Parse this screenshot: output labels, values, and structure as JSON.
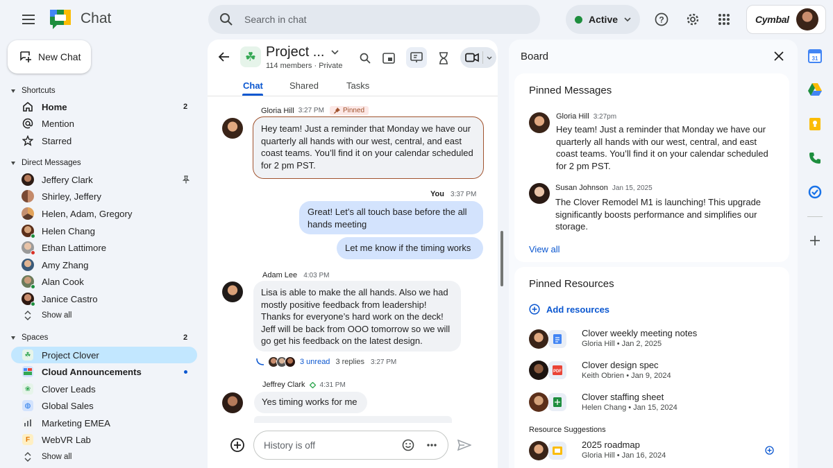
{
  "app": {
    "title": "Chat",
    "brand": "Cymbal"
  },
  "search": {
    "placeholder": "Search in chat"
  },
  "status": {
    "label": "Active",
    "color": "#1e8e3e"
  },
  "left_nav": {
    "new_chat_label": "New Chat",
    "shortcuts": {
      "header": "Shortcuts",
      "items": [
        {
          "label": "Home",
          "badge": "2",
          "icon": "home-icon"
        },
        {
          "label": "Mention",
          "icon": "at-icon"
        },
        {
          "label": "Starred",
          "icon": "star-icon"
        }
      ]
    },
    "direct_messages": {
      "header": "Direct Messages",
      "items": [
        {
          "label": "Jeffery Clark",
          "pinned": true
        },
        {
          "label": "Shirley, Jeffery"
        },
        {
          "label": "Helen, Adam, Gregory"
        },
        {
          "label": "Helen Chang"
        },
        {
          "label": "Ethan Lattimore"
        },
        {
          "label": "Amy Zhang"
        },
        {
          "label": "Alan Cook"
        },
        {
          "label": "Janice Castro"
        }
      ],
      "show_all": "Show all"
    },
    "spaces": {
      "header": "Spaces",
      "badge": "2",
      "items": [
        {
          "label": "Project Clover",
          "active": true
        },
        {
          "label": "Cloud Announcements",
          "bold": true,
          "unread_dot": true
        },
        {
          "label": "Clover Leads"
        },
        {
          "label": "Global Sales"
        },
        {
          "label": "Marketing EMEA"
        },
        {
          "label": "WebVR Lab",
          "icon_letter": "F"
        }
      ],
      "show_all": "Show all"
    }
  },
  "chat": {
    "space_name": "Project ...",
    "space_meta": "114 members · Private",
    "tabs": [
      "Chat",
      "Shared",
      "Tasks"
    ],
    "active_tab": "Chat",
    "messages": {
      "m1": {
        "sender": "Gloria Hill",
        "time": "3:27 PM",
        "pinned_label": "Pinned",
        "text": "Hey team! Just a reminder that Monday we have our quarterly all hands with our west, central, and east coast teams. You’ll find it on your calendar scheduled for 2 pm PST."
      },
      "m2": {
        "sender": "You",
        "time": "3:37 PM",
        "text": "Great! Let’s all touch base before the all hands meeting",
        "text2": "Let me know if the timing works"
      },
      "m3": {
        "sender": "Adam Lee",
        "time": "4:03 PM",
        "text": "Lisa is able to make the all hands. Also we had mostly positive feedback from leadership! Thanks for everyone’s hard work on the deck! Jeff will  be back from OOO tomorrow so we will go get his feedback on the latest design.",
        "unread": "3 unread",
        "replies": "3 replies",
        "reply_time": "3:27 PM"
      },
      "m4": {
        "sender": "Jeffrey Clark",
        "time": "4:31 PM",
        "text": "Yes timing works for me"
      }
    },
    "composer_placeholder": "History is off"
  },
  "board": {
    "title": "Board",
    "pinned_messages": {
      "header": "Pinned Messages",
      "items": [
        {
          "sender": "Gloria Hill",
          "time": "3:27pm",
          "text": "Hey team! Just a reminder that Monday we have our quarterly all hands with our west, central, and east coast teams. You’ll find it on your calendar scheduled for 2 pm PST."
        },
        {
          "sender": "Susan Johnson",
          "time": "Jan 15, 2025",
          "text": "The Clover Remodel M1 is launching! This upgrade significantly boosts performance and simplifies our storage."
        }
      ],
      "view_all": "View all"
    },
    "pinned_resources": {
      "header": "Pinned Resources",
      "add_label": "Add resources",
      "items": [
        {
          "title": "Clover weekly meeting notes",
          "sub": "Gloria Hill  •  Jan 2, 2025",
          "file_icon": "docs-icon"
        },
        {
          "title": "Clover design spec",
          "sub": "Keith Obrien  •  Jan 9, 2024",
          "file_icon": "pdf-icon"
        },
        {
          "title": "Clover staffing sheet",
          "sub": "Helen Chang  •  Jan 15, 2024",
          "file_icon": "sheets-icon"
        }
      ],
      "suggestions_header": "Resource Suggestions",
      "suggestions": [
        {
          "title": "2025 roadmap",
          "sub": "Gloria Hill  •  Jan 16, 2024",
          "file_icon": "slides-icon"
        }
      ]
    }
  },
  "colors": {
    "accent": "#0b57d0",
    "active_nav": "#c2e7ff",
    "pinned_border": "#a0522d"
  }
}
